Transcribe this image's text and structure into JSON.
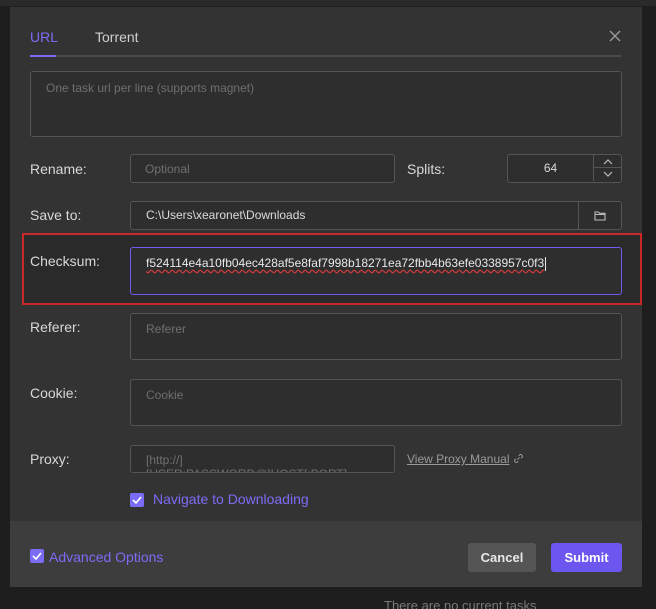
{
  "tabs": [
    {
      "label": "URL",
      "active": true
    },
    {
      "label": "Torrent",
      "active": false
    }
  ],
  "url_input": {
    "placeholder": "One task url per line (supports magnet)",
    "value": ""
  },
  "rename": {
    "label": "Rename:",
    "placeholder": "Optional"
  },
  "splits": {
    "label": "Splits:",
    "value": "64"
  },
  "save_to": {
    "label": "Save to:",
    "value": "C:\\Users\\xearonet\\Downloads"
  },
  "checksum": {
    "label": "Checksum:",
    "value": "f524114e4a10fb04ec428af5e8faf7998b18271ea72fbb4b63efe0338957c0f3"
  },
  "referer": {
    "label": "Referer:",
    "placeholder": "Referer"
  },
  "cookie": {
    "label": "Cookie:",
    "placeholder": "Cookie"
  },
  "proxy": {
    "label": "Proxy:",
    "placeholder": "[http://][USER:PASSWORD@]HOST[:PORT]",
    "manual_link": "View Proxy Manual"
  },
  "navigate": {
    "label": "Navigate to Downloading",
    "checked": true
  },
  "footer": {
    "advanced_label": "Advanced Options",
    "advanced_checked": true,
    "cancel_label": "Cancel",
    "submit_label": "Submit"
  },
  "background": {
    "status_text": "There are no current tasks"
  },
  "colors": {
    "accent": "#7b6cf6",
    "highlight": "#c8282a",
    "dialog_bg": "#333333"
  }
}
